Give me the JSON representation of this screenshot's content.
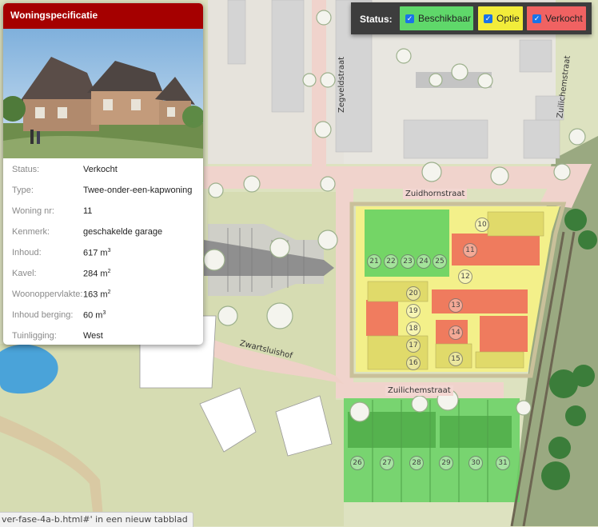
{
  "legend": {
    "title": "Status:",
    "options": [
      {
        "label": "Beschikbaar",
        "checked": true,
        "color": "#5fd86a"
      },
      {
        "label": "Optie",
        "checked": true,
        "color": "#f2ec3a"
      },
      {
        "label": "Verkocht",
        "checked": true,
        "color": "#f06262"
      }
    ]
  },
  "panel": {
    "title": "Woningspecificatie",
    "rows": [
      {
        "label": "Status:",
        "value": "Verkocht"
      },
      {
        "label": "Type:",
        "value": "Twee-onder-een-kapwoning"
      },
      {
        "label": "Woning nr:",
        "value": "11"
      },
      {
        "label": "Kenmerk:",
        "value": "geschakelde garage"
      },
      {
        "label": "Inhoud:",
        "value": "617 m",
        "sup": "3"
      },
      {
        "label": "Kavel:",
        "value": "284 m",
        "sup": "2"
      },
      {
        "label": "Woonoppervlakte:",
        "value": "163 m",
        "sup": "2"
      },
      {
        "label": "Inhoud berging:",
        "value": "60 m",
        "sup": "3"
      },
      {
        "label": "Tuinligging:",
        "value": "West"
      }
    ]
  },
  "streets": {
    "zuidhornstraat": "Zuidhornstraat",
    "zuilichemstraat_bottom": "Zuilichemstraat",
    "zuilichemstraat_right": "Zuilichemstraat",
    "zegveldstraat": "Zegveldstraat",
    "zwartsluishof": "Zwartsluishof"
  },
  "lots": {
    "l10": "10",
    "l11": "11",
    "l12": "12",
    "l13": "13",
    "l14": "14",
    "l15": "15",
    "l16": "16",
    "l17": "17",
    "l18": "18",
    "l19": "19",
    "l20": "20",
    "l21": "21",
    "l22": "22",
    "l23": "23",
    "l24": "24",
    "l25": "25",
    "l26": "26",
    "l27": "27",
    "l28": "28",
    "l29": "29",
    "l30": "30",
    "l31": "31"
  },
  "statusbar": {
    "text": "ver-fase-4a-b.html#' in een nieuw tabblad"
  }
}
